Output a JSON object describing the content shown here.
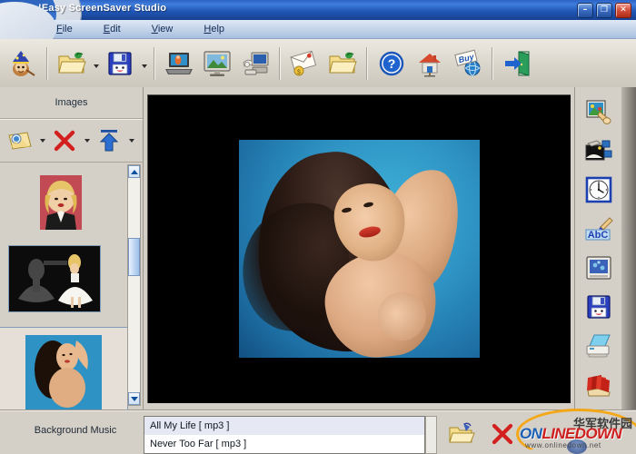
{
  "window": {
    "title": "!Easy ScreenSaver Studio",
    "controls": [
      {
        "name": "minimize",
        "glyph": "–"
      },
      {
        "name": "maximize",
        "glyph": "❐"
      },
      {
        "name": "close",
        "glyph": "✕"
      }
    ]
  },
  "menubar": {
    "items": [
      {
        "accel": "F",
        "rest": "ile"
      },
      {
        "accel": "E",
        "rest": "dit"
      },
      {
        "accel": "V",
        "rest": "iew"
      },
      {
        "accel": "H",
        "rest": "elp"
      }
    ]
  },
  "toolbar": {
    "buttons": [
      {
        "name": "wizard-icon",
        "label": "Wizard"
      },
      {
        "name": "open-folder-icon",
        "label": "Open",
        "dropdown": true
      },
      {
        "name": "save-floppy-icon",
        "label": "Save",
        "dropdown": true
      },
      {
        "name": "preview-laptop-icon",
        "label": "Preview"
      },
      {
        "name": "screen-picture-icon",
        "label": "Screen"
      },
      {
        "name": "install-computer-icon",
        "label": "Install"
      },
      {
        "name": "send-email-icon",
        "label": "Send"
      },
      {
        "name": "folder-icon",
        "label": "Folder"
      },
      {
        "name": "help-question-icon",
        "label": "Help"
      },
      {
        "name": "home-house-icon",
        "label": "Home"
      },
      {
        "name": "buy-globe-icon",
        "label": "Buy"
      },
      {
        "name": "exit-door-icon",
        "label": "Exit"
      }
    ]
  },
  "left_panel": {
    "header": "Images",
    "buttons": [
      {
        "name": "add-image-button",
        "label": "Add",
        "dropdown": true
      },
      {
        "name": "delete-image-button",
        "label": "Delete",
        "dropdown": true
      },
      {
        "name": "move-up-image-button",
        "label": "Move Up",
        "dropdown": true
      }
    ],
    "thumbnails": [
      {
        "name": "thumbnail-1",
        "selected": false
      },
      {
        "name": "thumbnail-2",
        "selected": true
      },
      {
        "name": "thumbnail-3",
        "selected": true
      }
    ],
    "scrollbar": {
      "up": "▲",
      "down": "▼"
    }
  },
  "preview": {
    "name": "image-preview",
    "background_color": "#000000",
    "photo_background_color": "#2e93c4"
  },
  "right_toolbar": {
    "buttons": [
      {
        "name": "image-effects-icon",
        "label": "Image Effects"
      },
      {
        "name": "transition-effects-icon",
        "label": "Transition Effects"
      },
      {
        "name": "timing-clock-icon",
        "label": "Timing"
      },
      {
        "name": "text-abc-icon",
        "label": "Text"
      },
      {
        "name": "screen-settings-icon",
        "label": "Screen Settings"
      },
      {
        "name": "save-project-icon",
        "label": "Save Project"
      },
      {
        "name": "print-icon",
        "label": "Print"
      },
      {
        "name": "publish-icon",
        "label": "Publish"
      }
    ]
  },
  "bottom": {
    "label": "Background Music",
    "music": [
      {
        "title": "All My Life [  mp3  ]",
        "selected": true
      },
      {
        "title": "Never Too Far [  mp3  ]",
        "selected": false
      }
    ],
    "buttons": [
      {
        "name": "add-music-button",
        "label": "Add Music"
      },
      {
        "name": "delete-music-button",
        "label": "Delete Music"
      }
    ]
  },
  "watermark": {
    "chinese": "华军软件园",
    "brand_on": "ON",
    "brand_line": "LINEDOWN",
    "url": "www.onlinedown.net",
    "accent_color": "#1a5fb4",
    "swoosh_color": "#f5a30a"
  }
}
